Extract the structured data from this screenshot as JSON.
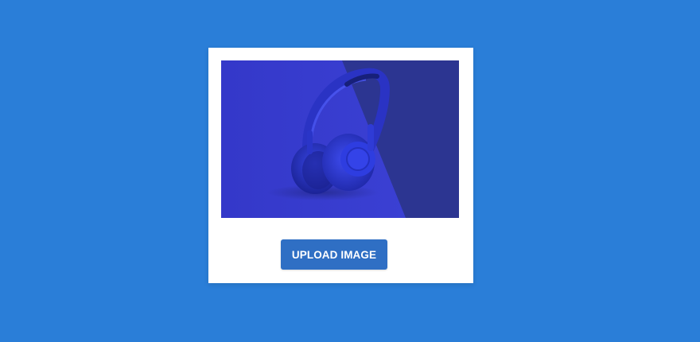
{
  "upload": {
    "button_label": "UPLOAD IMAGE"
  },
  "preview": {
    "image_alt": "headphones-photo",
    "colors": {
      "background_left": "#3a3fd2",
      "background_right": "#2c3591",
      "headphones": "#2d3bd8",
      "button": "#2f6fc4",
      "page": "#2a7ed8"
    }
  }
}
